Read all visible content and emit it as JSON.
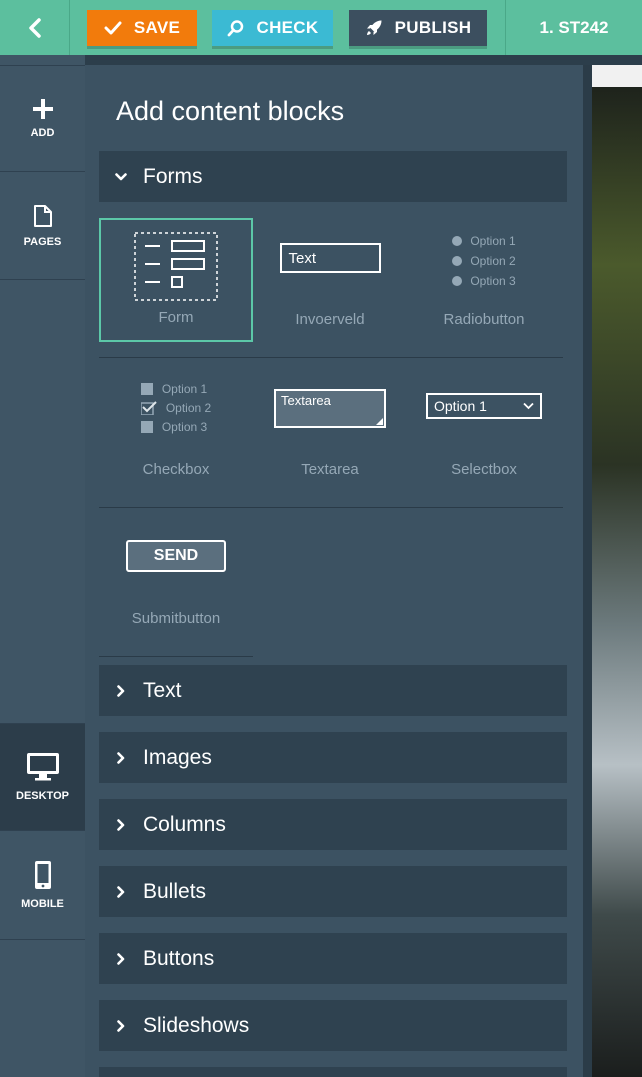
{
  "topbar": {
    "save_label": "SAVE",
    "check_label": "CHECK",
    "publish_label": "PUBLISH",
    "project_label": "1. ST242"
  },
  "leftnav": {
    "add": "ADD",
    "pages": "PAGES",
    "desktop": "DESKTOP",
    "mobile": "MOBILE"
  },
  "panel": {
    "title": "Add content blocks",
    "open_category": "Forms",
    "blocks": {
      "form": "Form",
      "input": "Invoerveld",
      "input_sample": "Text",
      "radio": "Radiobutton",
      "radio_options": [
        "Option 1",
        "Option 2",
        "Option 3"
      ],
      "checkbox": "Checkbox",
      "checkbox_options": [
        "Option 1",
        "Option 2",
        "Option 3"
      ],
      "textarea": "Textarea",
      "textarea_sample": "Textarea",
      "selectbox": "Selectbox",
      "select_sample": "Option 1",
      "submit": "Submitbutton",
      "submit_sample": "SEND"
    },
    "categories": [
      "Text",
      "Images",
      "Columns",
      "Bullets",
      "Buttons",
      "Slideshows"
    ]
  },
  "colors": {
    "topbar": "#5cbf9e",
    "save": "#f27b0c",
    "check": "#3bbad3",
    "publish": "#3c4f5f",
    "selected_border": "#5cc8a8"
  }
}
